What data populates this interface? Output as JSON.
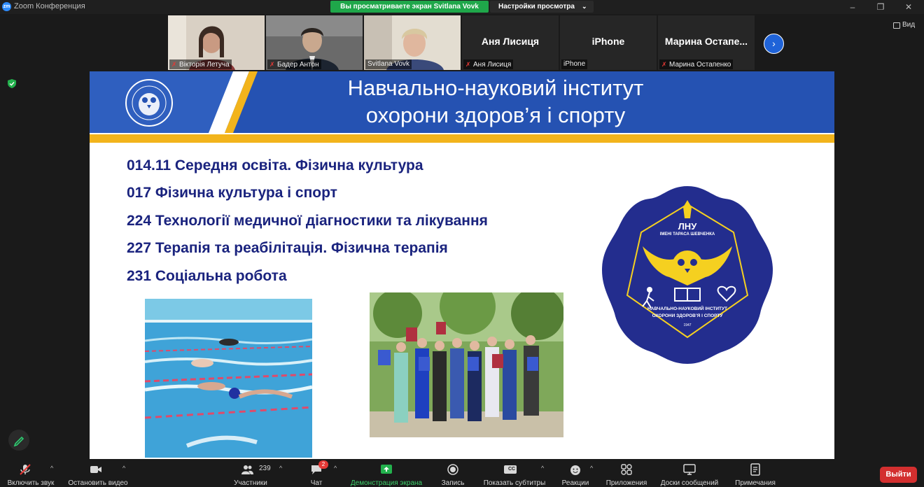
{
  "app": {
    "icon_text": "zm",
    "title": "Zoom Конференция",
    "share_banner": "Вы просматриваете экран Svitlana Vovk",
    "view_options": "Настройки просмотра",
    "view_toggle": "Вид"
  },
  "participants": [
    {
      "name": "Вікторія Летуча",
      "muted": true,
      "video": true
    },
    {
      "name": "Бадер Антон",
      "muted": true,
      "video": true
    },
    {
      "name": "Svitlana Vovk",
      "muted": false,
      "video": true,
      "active_speaker": true
    },
    {
      "name": "Аня Лисиця",
      "display": "Аня Лисиця",
      "muted": true,
      "video": false
    },
    {
      "name": "iPhone",
      "display": "iPhone",
      "muted": false,
      "video": false
    },
    {
      "name": "Марина Остапенко",
      "display": "Марина  Остапе...",
      "muted": true,
      "video": false
    }
  ],
  "slide": {
    "title_line1": "Навчально-науковий інститут",
    "title_line2": "охорони здоров’я  і спорту",
    "specialties": [
      "014.11 Середня освіта. Фізична культура",
      "017  Фізична культура і спорт",
      "224 Технології медичної діагностики та лікування",
      "227  Терапія та реабілітація. Фізична терапія",
      "231 Соціальна робота"
    ],
    "logo": {
      "abbr": "ЛНУ",
      "sub": "ІМЕНІ ТАРАСА ШЕВЧЕНКА",
      "line1": "НАВЧАЛЬНО-НАУКОВИЙ ІНСТИТУТ",
      "line2": "ОХОРОНИ ЗДОРОВ’Я І СПОРТУ",
      "year": "1947"
    }
  },
  "toolbar": {
    "audio": "Включить звук",
    "video": "Остановить видео",
    "participants": "Участники",
    "participants_count": "239",
    "chat": "Чат",
    "chat_badge": "2",
    "share": "Демонстрация экрана",
    "record": "Запись",
    "captions": "Показать субтитры",
    "captions_icon_text": "CC",
    "reactions": "Реакции",
    "apps": "Приложения",
    "whiteboards": "Доски сообщений",
    "notes": "Примечания",
    "exit": "Выйти"
  },
  "colors": {
    "share_green": "#1fa74a",
    "slide_blue": "#2552b2",
    "slide_gold": "#f2b41c",
    "text_navy": "#1a237e",
    "exit_red": "#d32f2f"
  }
}
